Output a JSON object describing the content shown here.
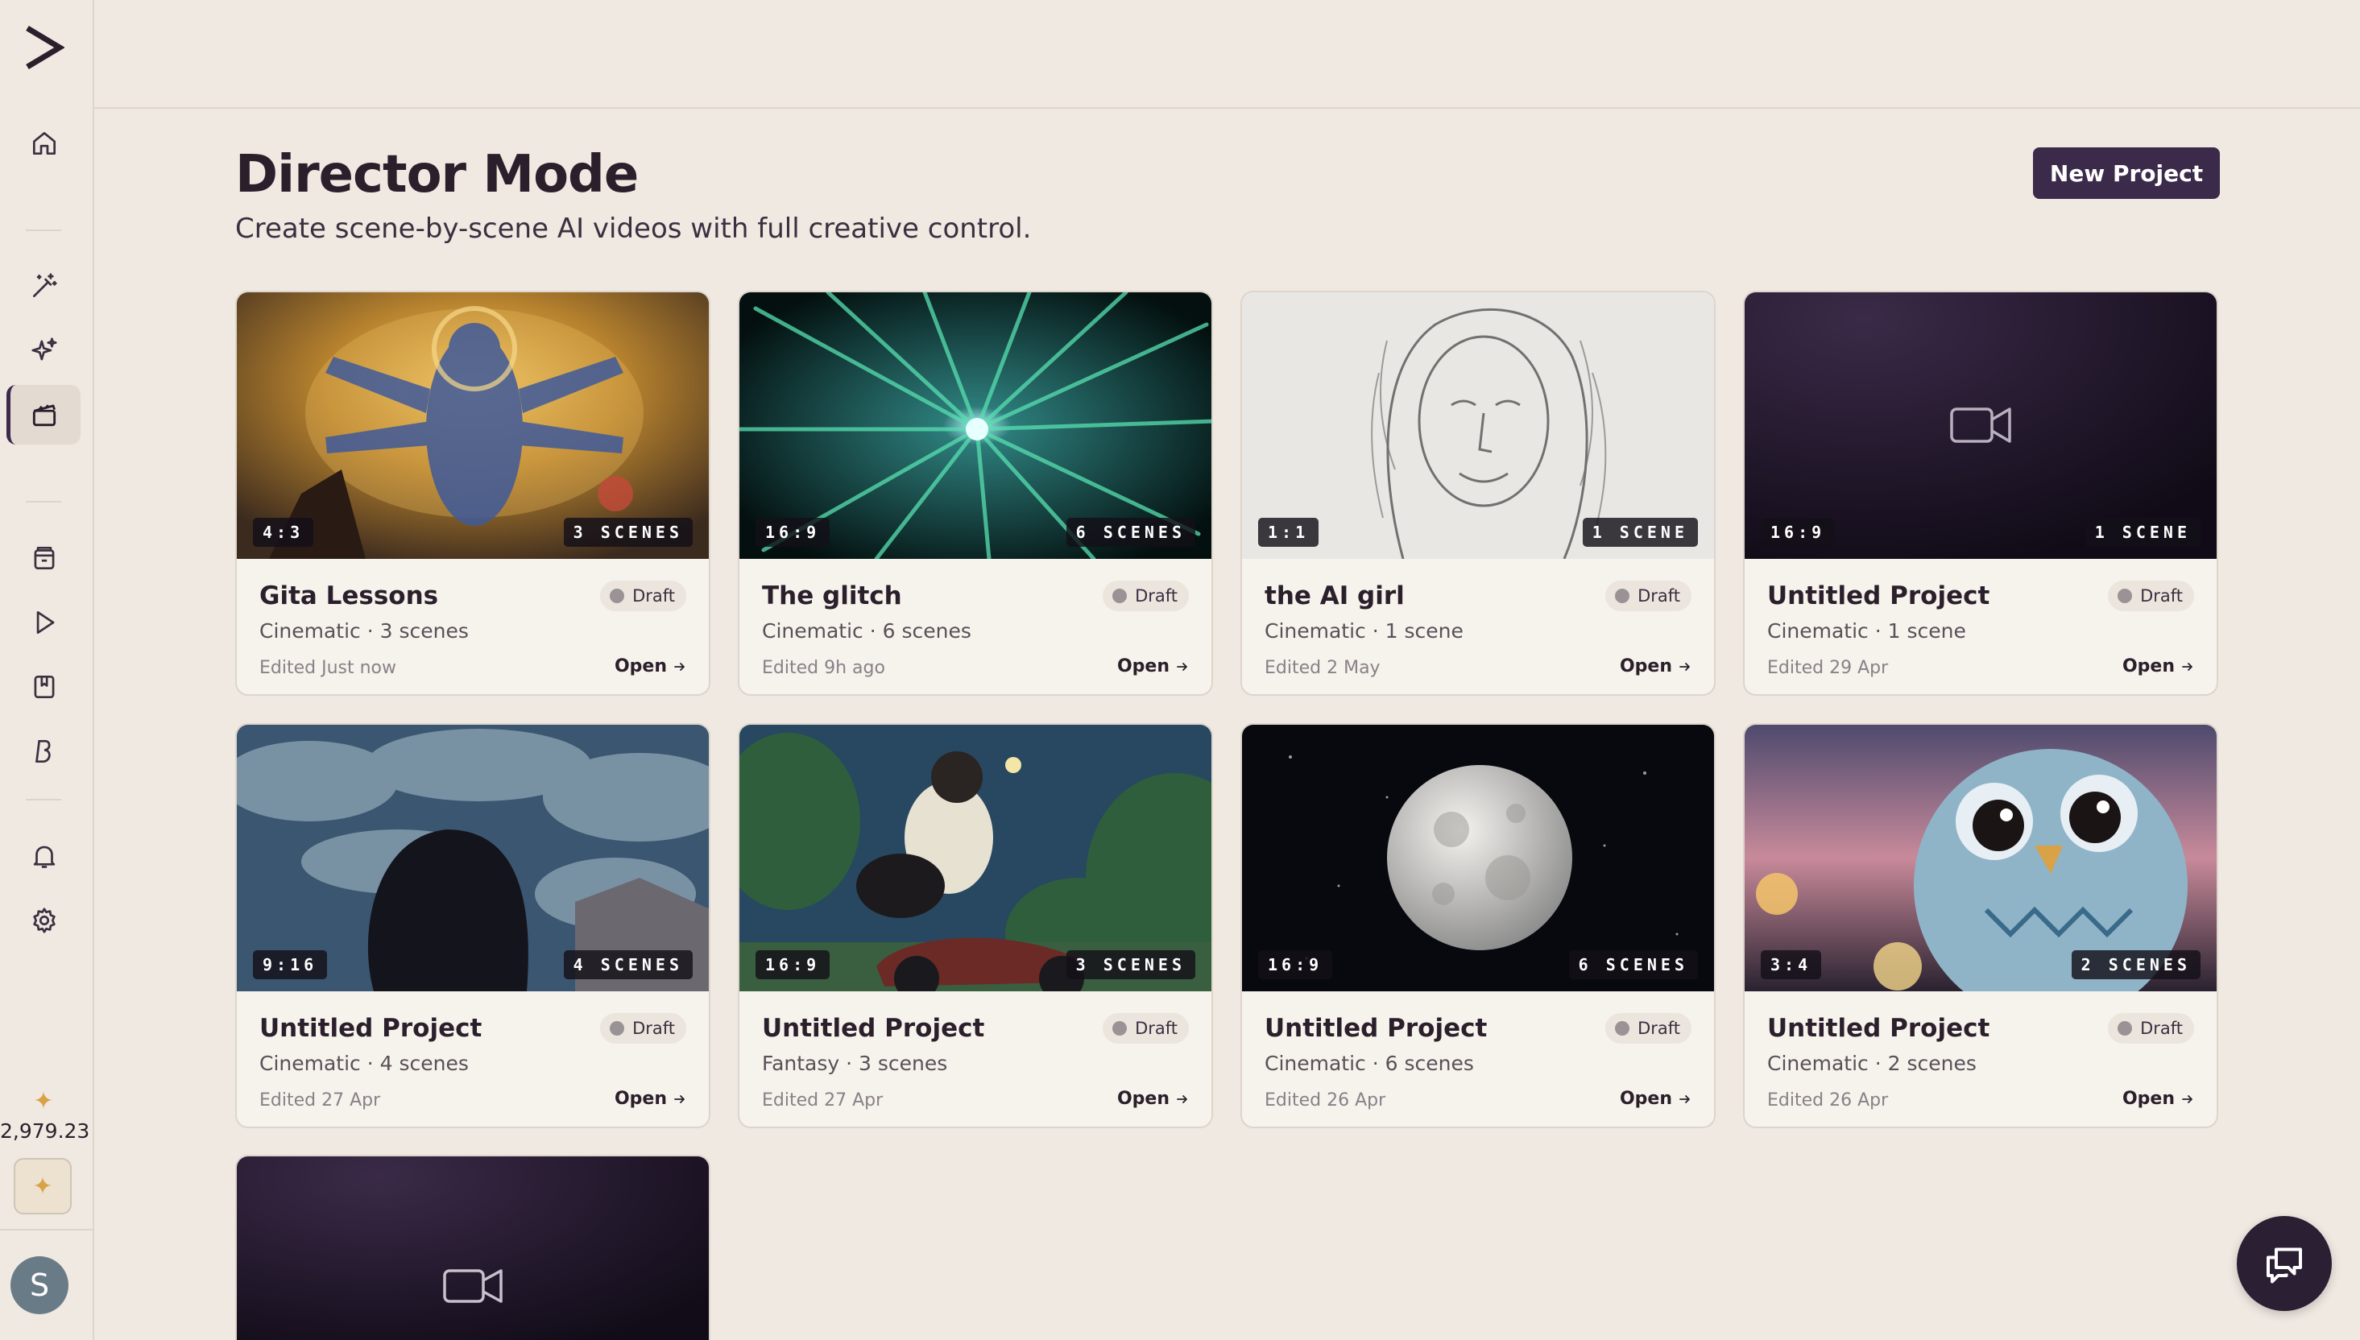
{
  "header": {
    "title": "Director Mode",
    "subtitle": "Create scene-by-scene AI videos with full creative control.",
    "new_project_label": "New Project"
  },
  "sidebar": {
    "credits_value": "2,979.23",
    "avatar_initial": "S",
    "icons": [
      "home-icon",
      "magic-wand-icon",
      "sparkles-icon",
      "clapperboard-icon",
      "archive-icon",
      "play-icon",
      "bookmark-box-icon",
      "brand-b-icon",
      "bell-icon",
      "gear-icon"
    ]
  },
  "projects": [
    {
      "title": "Gita Lessons",
      "status": "Draft",
      "meta": "Cinematic · 3 scenes",
      "edited": "Edited Just now",
      "ratio": "4:3",
      "scenes": "3 SCENES",
      "open": "Open"
    },
    {
      "title": "The glitch",
      "status": "Draft",
      "meta": "Cinematic · 6 scenes",
      "edited": "Edited 9h ago",
      "ratio": "16:9",
      "scenes": "6 SCENES",
      "open": "Open"
    },
    {
      "title": "the AI girl",
      "status": "Draft",
      "meta": "Cinematic · 1 scene",
      "edited": "Edited 2 May",
      "ratio": "1:1",
      "scenes": "1 SCENE",
      "open": "Open"
    },
    {
      "title": "Untitled Project",
      "status": "Draft",
      "meta": "Cinematic · 1 scene",
      "edited": "Edited 29 Apr",
      "ratio": "16:9",
      "scenes": "1 SCENE",
      "open": "Open"
    },
    {
      "title": "Untitled Project",
      "status": "Draft",
      "meta": "Cinematic · 4 scenes",
      "edited": "Edited 27 Apr",
      "ratio": "9:16",
      "scenes": "4 SCENES",
      "open": "Open"
    },
    {
      "title": "Untitled Project",
      "status": "Draft",
      "meta": "Fantasy · 3 scenes",
      "edited": "Edited 27 Apr",
      "ratio": "16:9",
      "scenes": "3 SCENES",
      "open": "Open"
    },
    {
      "title": "Untitled Project",
      "status": "Draft",
      "meta": "Cinematic · 6 scenes",
      "edited": "Edited 26 Apr",
      "ratio": "16:9",
      "scenes": "6 SCENES",
      "open": "Open"
    },
    {
      "title": "Untitled Project",
      "status": "Draft",
      "meta": "Cinematic · 2 scenes",
      "edited": "Edited 26 Apr",
      "ratio": "3:4",
      "scenes": "2 SCENES",
      "open": "Open"
    }
  ],
  "colors": {
    "background": "#efe9e2",
    "accent": "#3c2a4b",
    "card": "#f6f2ec",
    "credits": "#d9a246"
  }
}
